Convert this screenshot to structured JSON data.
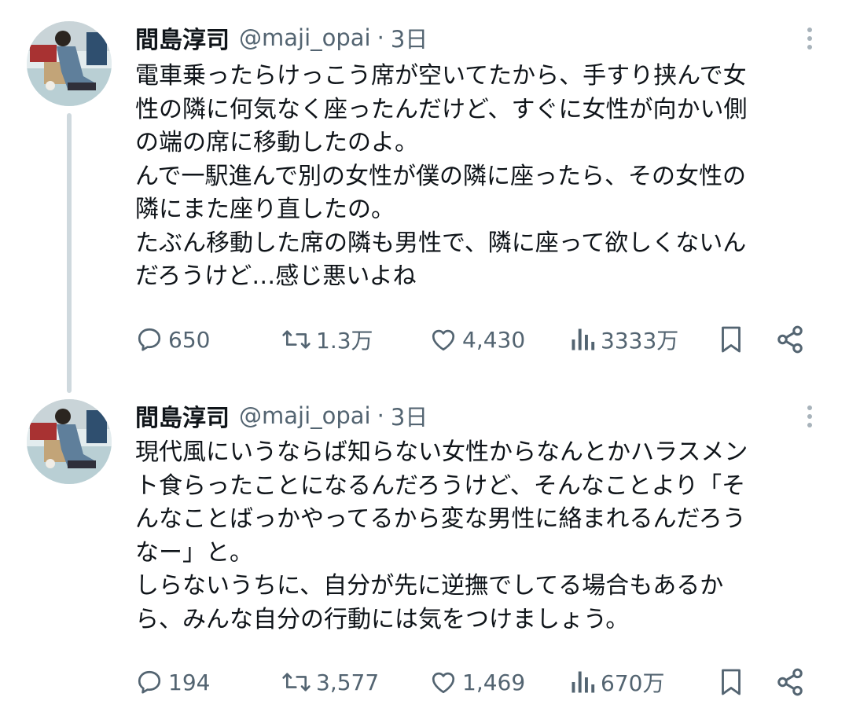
{
  "colors": {
    "text_primary": "#0f1419",
    "text_secondary": "#536471",
    "thread_line": "#cfd9de",
    "background": "#ffffff"
  },
  "tweets": [
    {
      "author": {
        "display_name": "間島淳司",
        "handle": "@maji_opai",
        "avatar_icon": "user-avatar-photo"
      },
      "separator": "·",
      "time": "3日",
      "text_lines": [
        "電車乗ったらけっこう席が空いてたから、手すり挟んで女",
        "性の隣に何気なく座ったんだけど、すぐに女性が向かい側",
        "の端の席に移動したのよ。",
        "んで一駅進んで別の女性が僕の隣に座ったら、その女性の",
        "隣にまた座り直したの。",
        "たぶん移動した席の隣も男性で、隣に座って欲しくないん",
        "だろうけど…感じ悪いよね"
      ],
      "actions": {
        "reply": {
          "icon": "reply-icon",
          "count": "650"
        },
        "retweet": {
          "icon": "retweet-icon",
          "count": "1.3万"
        },
        "like": {
          "icon": "heart-icon",
          "count": "4,430"
        },
        "views": {
          "icon": "views-chart-icon",
          "count": "3333万"
        },
        "bookmark": {
          "icon": "bookmark-icon"
        },
        "share": {
          "icon": "share-icon"
        }
      }
    },
    {
      "author": {
        "display_name": "間島淳司",
        "handle": "@maji_opai",
        "avatar_icon": "user-avatar-photo"
      },
      "separator": "·",
      "time": "3日",
      "text_lines": [
        "現代風にいうならば知らない女性からなんとかハラスメン",
        "ト食らったことになるんだろうけど、そんなことより「そ",
        "んなことばっかやってるから変な男性に絡まれるんだろう",
        "なー」と。",
        "しらないうちに、自分が先に逆撫でしてる場合もあるか",
        "ら、みんな自分の行動には気をつけましょう。"
      ],
      "actions": {
        "reply": {
          "icon": "reply-icon",
          "count": "194"
        },
        "retweet": {
          "icon": "retweet-icon",
          "count": "3,577"
        },
        "like": {
          "icon": "heart-icon",
          "count": "1,469"
        },
        "views": {
          "icon": "views-chart-icon",
          "count": "670万"
        },
        "bookmark": {
          "icon": "bookmark-icon"
        },
        "share": {
          "icon": "share-icon"
        }
      }
    }
  ]
}
